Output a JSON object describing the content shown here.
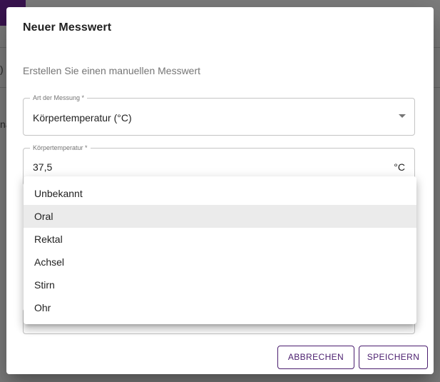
{
  "dialog": {
    "title": "Neuer Messwert",
    "subtitle": "Erstellen Sie einen manuellen Messwert"
  },
  "measurement_type": {
    "label": "Art der Messung *",
    "value": "Körpertemperatur (°C)"
  },
  "temperature": {
    "label": "Körpertemperatur *",
    "value": "37,5",
    "unit": "°C"
  },
  "dropdown": {
    "selected": "Oral",
    "options": [
      "Unbekannt",
      "Oral",
      "Rektal",
      "Achsel",
      "Stirn",
      "Ohr"
    ]
  },
  "actions": {
    "cancel_label": "ABBRECHEN",
    "save_label": "SPEICHERN"
  },
  "background": {
    "fragment_1": ")",
    "fragment_2": "na"
  },
  "colors": {
    "accent": "#4a1d6e",
    "selected_option": "#ebebeb"
  }
}
